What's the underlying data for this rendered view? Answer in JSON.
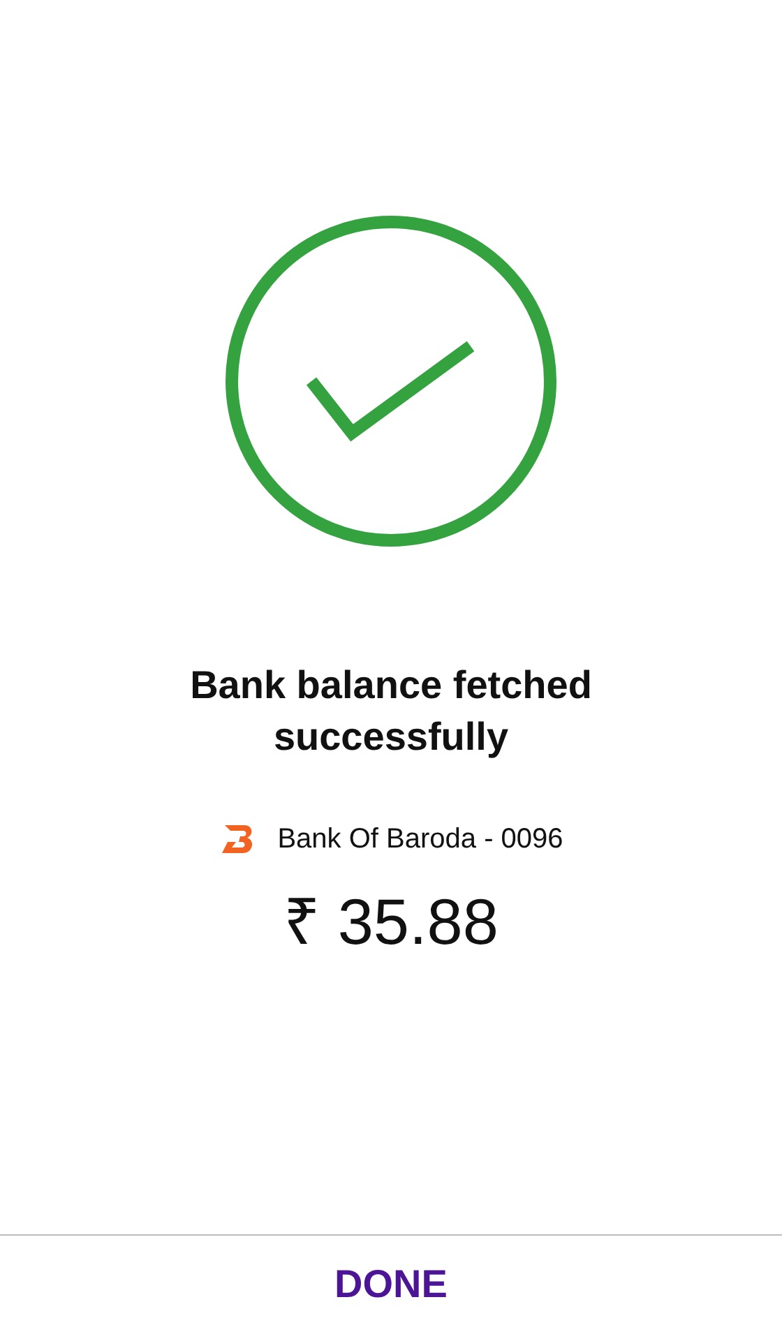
{
  "title": "Bank balance fetched successfully",
  "account": {
    "bank": "Bank Of Baroda - 0096"
  },
  "balance": "₹ 35.88",
  "done_button": "DONE"
}
